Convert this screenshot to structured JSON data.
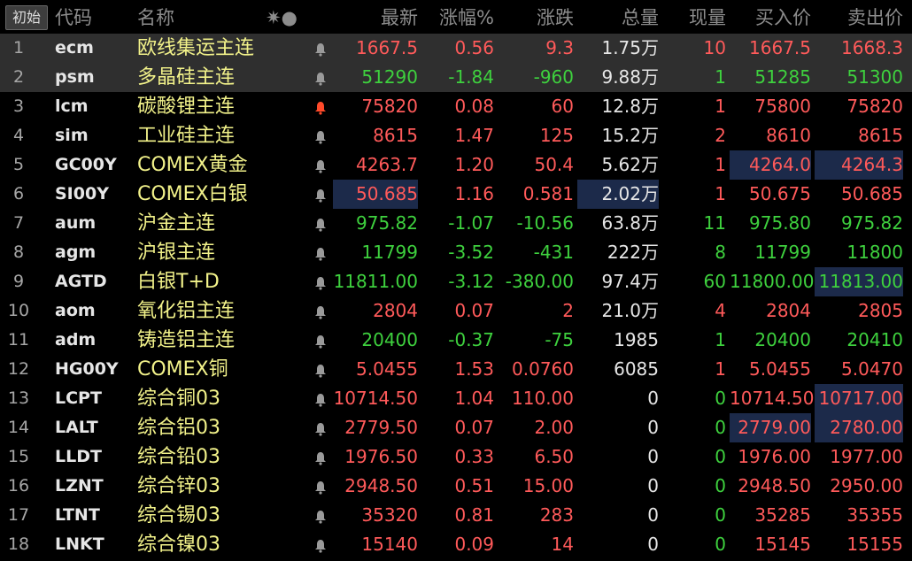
{
  "header": {
    "init_button": "初始",
    "code": "代码",
    "name": "名称",
    "icons": "✷●",
    "last": "最新",
    "pct": "涨幅%",
    "chg": "涨跌",
    "vol": "总量",
    "cur": "现量",
    "bid": "买入价",
    "ask": "卖出价"
  },
  "colors": {
    "up": "#ff5a5a",
    "down": "#3ed13e",
    "name": "#f2f28a",
    "bell_active": "#ff4a2a",
    "bell": "#9a9a9a",
    "highlight": "#1c2a4a"
  },
  "rows": [
    {
      "idx": "1",
      "code": "ecm",
      "name": "欧线集运主连",
      "bell": "bell-icon",
      "last": "1667.5",
      "pct": "0.56",
      "chg": "9.3",
      "vol": "1.75万",
      "cur": "10",
      "bid": "1667.5",
      "ask": "1668.3"
    },
    {
      "idx": "2",
      "code": "psm",
      "name": "多晶硅主连",
      "bell": "bell-icon",
      "last": "51290",
      "pct": "-1.84",
      "chg": "-960",
      "vol": "9.88万",
      "cur": "1",
      "bid": "51285",
      "ask": "51300"
    },
    {
      "idx": "3",
      "code": "lcm",
      "name": "碳酸锂主连",
      "bell": "bell-icon-active",
      "last": "75820",
      "pct": "0.08",
      "chg": "60",
      "vol": "12.8万",
      "cur": "1",
      "bid": "75800",
      "ask": "75820"
    },
    {
      "idx": "4",
      "code": "sim",
      "name": "工业硅主连",
      "bell": "bell-icon",
      "last": "8615",
      "pct": "1.47",
      "chg": "125",
      "vol": "15.2万",
      "cur": "2",
      "bid": "8610",
      "ask": "8615"
    },
    {
      "idx": "5",
      "code": "GC00Y",
      "name": "COMEX黄金",
      "bell": "bell-icon",
      "last": "4263.7",
      "pct": "1.20",
      "chg": "50.4",
      "vol": "5.62万",
      "cur": "1",
      "bid": "4264.0",
      "ask": "4264.3"
    },
    {
      "idx": "6",
      "code": "SI00Y",
      "name": "COMEX白银",
      "bell": "bell-icon",
      "last": "50.685",
      "pct": "1.16",
      "chg": "0.581",
      "vol": "2.02万",
      "cur": "1",
      "bid": "50.675",
      "ask": "50.685"
    },
    {
      "idx": "7",
      "code": "aum",
      "name": "沪金主连",
      "bell": "bell-icon",
      "last": "975.82",
      "pct": "-1.07",
      "chg": "-10.56",
      "vol": "63.8万",
      "cur": "11",
      "bid": "975.80",
      "ask": "975.82"
    },
    {
      "idx": "8",
      "code": "agm",
      "name": "沪银主连",
      "bell": "bell-icon",
      "last": "11799",
      "pct": "-3.52",
      "chg": "-431",
      "vol": "222万",
      "cur": "8",
      "bid": "11799",
      "ask": "11800"
    },
    {
      "idx": "9",
      "code": "AGTD",
      "name": "白银T+D",
      "bell": "bell-icon",
      "last": "11811.00",
      "pct": "-3.12",
      "chg": "-380.00",
      "vol": "97.4万",
      "cur": "60",
      "bid": "11800.00",
      "ask": "11813.00"
    },
    {
      "idx": "10",
      "code": "aom",
      "name": "氧化铝主连",
      "bell": "bell-icon",
      "last": "2804",
      "pct": "0.07",
      "chg": "2",
      "vol": "21.0万",
      "cur": "4",
      "bid": "2804",
      "ask": "2805"
    },
    {
      "idx": "11",
      "code": "adm",
      "name": "铸造铝主连",
      "bell": "bell-icon",
      "last": "20400",
      "pct": "-0.37",
      "chg": "-75",
      "vol": "1985",
      "cur": "1",
      "bid": "20400",
      "ask": "20410"
    },
    {
      "idx": "12",
      "code": "HG00Y",
      "name": "COMEX铜",
      "bell": "bell-icon",
      "last": "5.0455",
      "pct": "1.53",
      "chg": "0.0760",
      "vol": "6085",
      "cur": "1",
      "bid": "5.0455",
      "ask": "5.0470"
    },
    {
      "idx": "13",
      "code": "LCPT",
      "name": "综合铜03",
      "bell": "bell-icon",
      "last": "10714.50",
      "pct": "1.04",
      "chg": "110.00",
      "vol": "0",
      "cur": "0",
      "bid": "10714.50",
      "ask": "10717.00"
    },
    {
      "idx": "14",
      "code": "LALT",
      "name": "综合铝03",
      "bell": "bell-icon",
      "last": "2779.50",
      "pct": "0.07",
      "chg": "2.00",
      "vol": "0",
      "cur": "0",
      "bid": "2779.00",
      "ask": "2780.00"
    },
    {
      "idx": "15",
      "code": "LLDT",
      "name": "综合铅03",
      "bell": "bell-icon",
      "last": "1976.50",
      "pct": "0.33",
      "chg": "6.50",
      "vol": "0",
      "cur": "0",
      "bid": "1976.00",
      "ask": "1977.00"
    },
    {
      "idx": "16",
      "code": "LZNT",
      "name": "综合锌03",
      "bell": "bell-icon",
      "last": "2948.50",
      "pct": "0.51",
      "chg": "15.00",
      "vol": "0",
      "cur": "0",
      "bid": "2948.50",
      "ask": "2950.00"
    },
    {
      "idx": "17",
      "code": "LTNT",
      "name": "综合锡03",
      "bell": "bell-icon",
      "last": "35320",
      "pct": "0.81",
      "chg": "283",
      "vol": "0",
      "cur": "0",
      "bid": "35285",
      "ask": "35355"
    },
    {
      "idx": "18",
      "code": "LNKT",
      "name": "综合镍03",
      "bell": "bell-icon",
      "last": "15140",
      "pct": "0.09",
      "chg": "14",
      "vol": "0",
      "cur": "0",
      "bid": "15145",
      "ask": "15155"
    }
  ]
}
